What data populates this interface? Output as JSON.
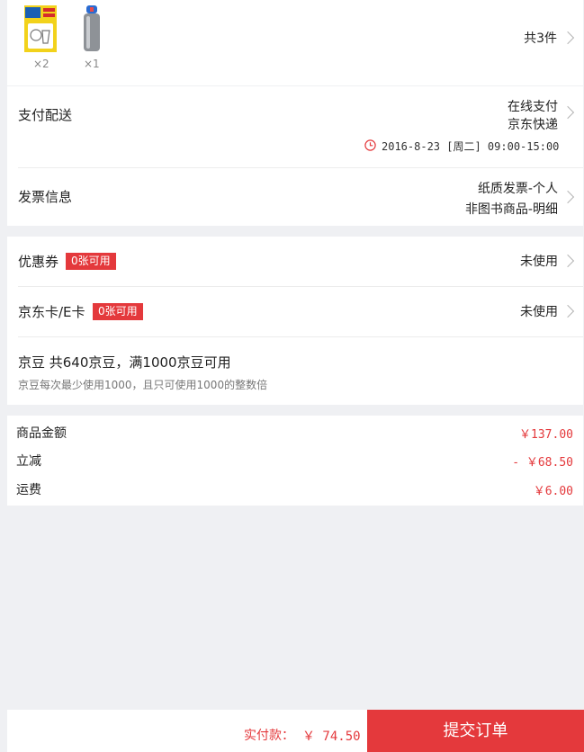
{
  "products": {
    "items": [
      {
        "icon": "detergent-box-icon",
        "qty": "×2"
      },
      {
        "icon": "water-bottle-icon",
        "qty": "×1"
      }
    ],
    "total_label": "共3件"
  },
  "payment_delivery": {
    "label": "支付配送",
    "payment_method": "在线支付",
    "courier": "京东快递",
    "time_icon": "clock-icon",
    "delivery_time": "2016-8-23 [周二] 09:00-15:00"
  },
  "invoice": {
    "label": "发票信息",
    "type": "纸质发票-个人",
    "content": "非图书商品-明细"
  },
  "coupon": {
    "label": "优惠券",
    "badge": "0张可用",
    "status": "未使用"
  },
  "jd_card": {
    "label": "京东卡/E卡",
    "badge": "0张可用",
    "status": "未使用"
  },
  "jingdou": {
    "title": "京豆 共640京豆，满1000京豆可用",
    "note": "京豆每次最少使用1000，且只可使用1000的整数倍"
  },
  "summary": {
    "goods_label": "商品金额",
    "goods_value": "￥137.00",
    "discount_label": "立减",
    "discount_value": "- ￥68.50",
    "shipping_label": "运费",
    "shipping_value": "￥6.00"
  },
  "footer": {
    "total_label": "实付款：",
    "total_value": "￥ 74.50",
    "submit_label": "提交订单"
  },
  "colors": {
    "accent": "#e4393c",
    "background": "#eff0f3"
  }
}
